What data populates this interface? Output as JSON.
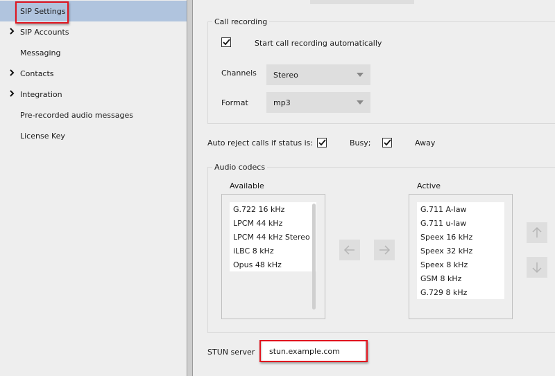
{
  "sidebar": {
    "items": [
      {
        "label": "SIP Settings",
        "expandable": false,
        "selected": true,
        "highlighted": true
      },
      {
        "label": "SIP Accounts",
        "expandable": true,
        "selected": false
      },
      {
        "label": "Messaging",
        "expandable": false,
        "selected": false
      },
      {
        "label": "Contacts",
        "expandable": true,
        "selected": false
      },
      {
        "label": "Integration",
        "expandable": true,
        "selected": false
      },
      {
        "label": "Pre-recorded audio messages",
        "expandable": false,
        "selected": false
      },
      {
        "label": "License Key",
        "expandable": false,
        "selected": false
      }
    ],
    "selected_color": "#b0c4de"
  },
  "call_recording": {
    "title": "Call recording",
    "auto_record": {
      "label": "Start call recording automatically",
      "checked": true
    },
    "channels": {
      "label": "Channels",
      "value": "Stereo"
    },
    "format": {
      "label": "Format",
      "value": "mp3"
    }
  },
  "auto_reject": {
    "label": "Auto reject calls if status is:",
    "busy": {
      "label": "Busy;",
      "checked": true
    },
    "away": {
      "label": "Away",
      "checked": true
    }
  },
  "audio_codecs": {
    "title": "Audio codecs",
    "available_label": "Available",
    "active_label": "Active",
    "available": [
      "G.722 16 kHz",
      "LPCM 44 kHz",
      "LPCM 44 kHz Stereo",
      "iLBC 8 kHz",
      "Opus 48 kHz"
    ],
    "active": [
      "G.711 A-law",
      "G.711 u-law",
      "Speex 16 kHz",
      "Speex 32 kHz",
      "Speex 8 kHz",
      "GSM 8 kHz",
      "G.729 8 kHz"
    ],
    "buttons": {
      "move_left": "arrow-left-icon",
      "move_right": "arrow-right-icon",
      "move_up": "arrow-up-icon",
      "move_down": "arrow-down-icon"
    }
  },
  "stun": {
    "label": "STUN server",
    "value": "stun.example.com",
    "highlighted": true
  },
  "colors": {
    "highlight_border": "#e0141e",
    "background": "#eeeeee"
  }
}
